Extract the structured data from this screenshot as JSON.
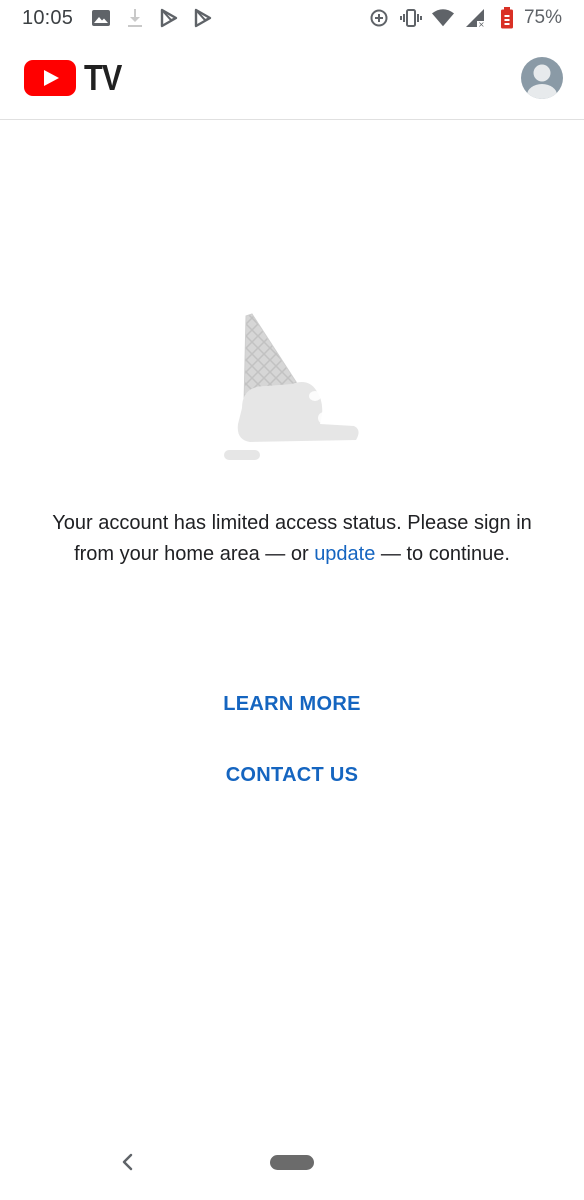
{
  "status_bar": {
    "time": "10:05",
    "battery_percent": "75%",
    "left_icons": [
      "image-icon",
      "download-icon",
      "play-store-icon",
      "play-store-icon"
    ],
    "right_icons": [
      "data-saver-icon",
      "vibrate-icon",
      "wifi-icon",
      "signal-icon",
      "battery-icon"
    ]
  },
  "app_bar": {
    "logo_text": "TV",
    "brand_color": "#ff0000"
  },
  "main": {
    "message_before": "Your account has limited access status. Please sign in from your home area — or ",
    "message_link": "update",
    "message_after": " — to continue.",
    "learn_more_label": "LEARN MORE",
    "contact_us_label": "CONTACT US",
    "accent_color": "#1565c0"
  }
}
